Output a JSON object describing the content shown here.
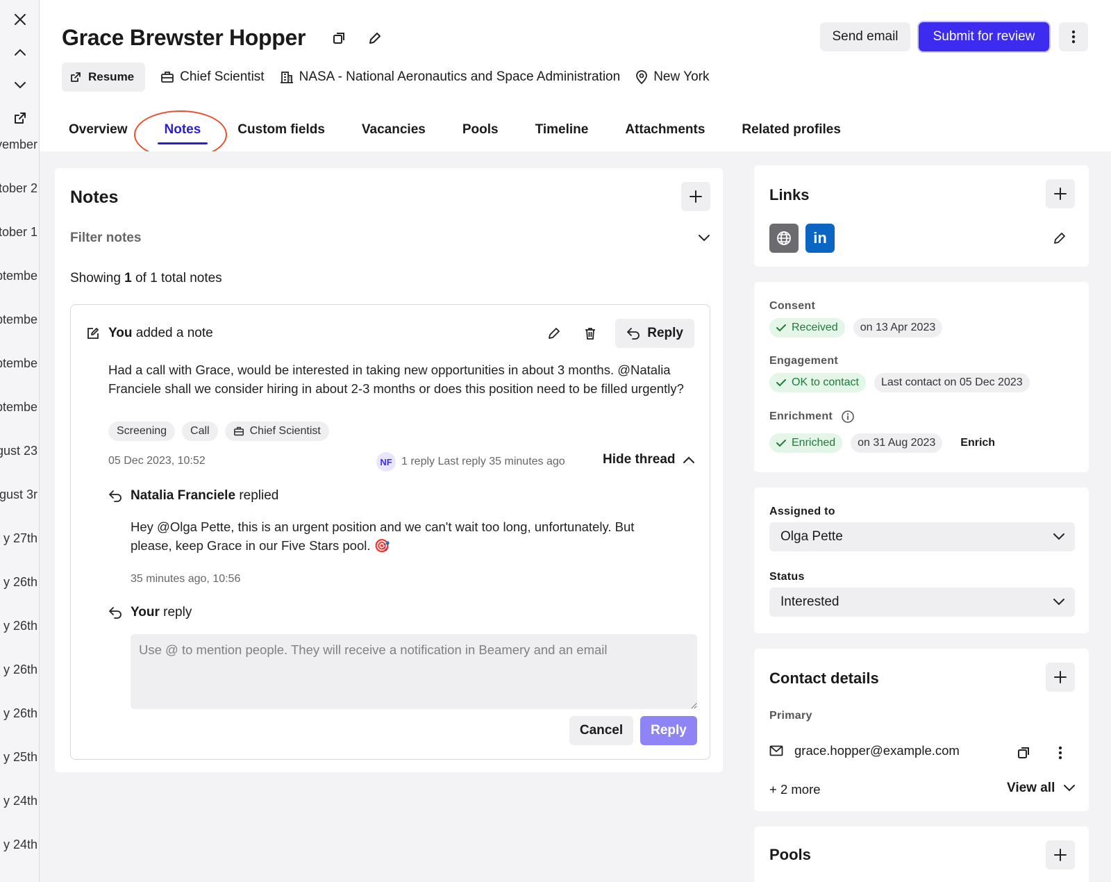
{
  "sidebar_dates": [
    "vember",
    "tober 2",
    "tober 1",
    "ptembe",
    "ptembe",
    "ptembe",
    "ptembe",
    "gust 23",
    "gust 3r",
    "y 27th",
    "y 26th",
    "y 26th",
    "y 26th",
    "y 26th",
    "y 25th",
    "y 24th",
    "y 24th"
  ],
  "profile": {
    "name": "Grace Brewster Hopper",
    "resume_label": "Resume",
    "title": "Chief Scientist",
    "company": "NASA - National Aeronautics and Space Administration",
    "location": "New York"
  },
  "actions": {
    "send_email": "Send email",
    "submit_review": "Submit for review"
  },
  "tabs": [
    {
      "label": "Overview"
    },
    {
      "label": "Notes",
      "active": true
    },
    {
      "label": "Custom fields"
    },
    {
      "label": "Vacancies"
    },
    {
      "label": "Pools"
    },
    {
      "label": "Timeline"
    },
    {
      "label": "Attachments"
    },
    {
      "label": "Related profiles"
    }
  ],
  "notes": {
    "title": "Notes",
    "filter_label": "Filter notes",
    "showing_prefix": "Showing",
    "showing_count": "1",
    "showing_suffix": "of 1 total notes",
    "note": {
      "author": "You",
      "action": "added a note",
      "reply_label": "Reply",
      "text": "Had a call with Grace, would be interested in taking new opportunities in about 3 months. @Natalia Franciele shall we consider hiring in about 2-3 months or does this position need to be filled urgently?",
      "tags": [
        "Screening",
        "Call",
        "Chief Scientist"
      ],
      "date": "05 Dec 2023, 10:52",
      "thread_avatar": "NF",
      "thread_info": "1 reply Last reply 35 minutes ago",
      "hide_thread": "Hide thread"
    },
    "reply": {
      "author": "Natalia Franciele",
      "action": "replied",
      "text": "Hey @Olga Pette, this is an urgent position and we can't wait too long, unfortunately. But please, keep Grace in our Five Stars pool. 🎯",
      "date": "35 minutes ago, 10:56"
    },
    "your_reply": {
      "author": "Your",
      "action": "reply",
      "placeholder": "Use @ to mention people. They will receive a notification in Beamery and an email",
      "cancel": "Cancel",
      "submit": "Reply"
    }
  },
  "links": {
    "title": "Links",
    "linkedin_label": "in"
  },
  "consent": {
    "consent_label": "Consent",
    "consent_status": "Received",
    "consent_date": "on 13 Apr 2023",
    "engagement_label": "Engagement",
    "engagement_status": "OK to contact",
    "engagement_date": "Last contact on 05 Dec 2023",
    "enrichment_label": "Enrichment",
    "enrichment_status": "Enriched",
    "enrichment_date": "on 31 Aug 2023",
    "enrich_action": "Enrich"
  },
  "assignment": {
    "assigned_label": "Assigned to",
    "assigned_value": "Olga Pette",
    "status_label": "Status",
    "status_value": "Interested"
  },
  "contact": {
    "title": "Contact details",
    "primary_label": "Primary",
    "email": "grace.hopper@example.com",
    "more": "+ 2 more",
    "view_all": "View all"
  },
  "pools": {
    "title": "Pools"
  },
  "colors": {
    "accent": "#3d2bf0",
    "annotation": "#ea4f2c",
    "linkedin": "#0a66c2",
    "success": "#1f7a3a"
  }
}
